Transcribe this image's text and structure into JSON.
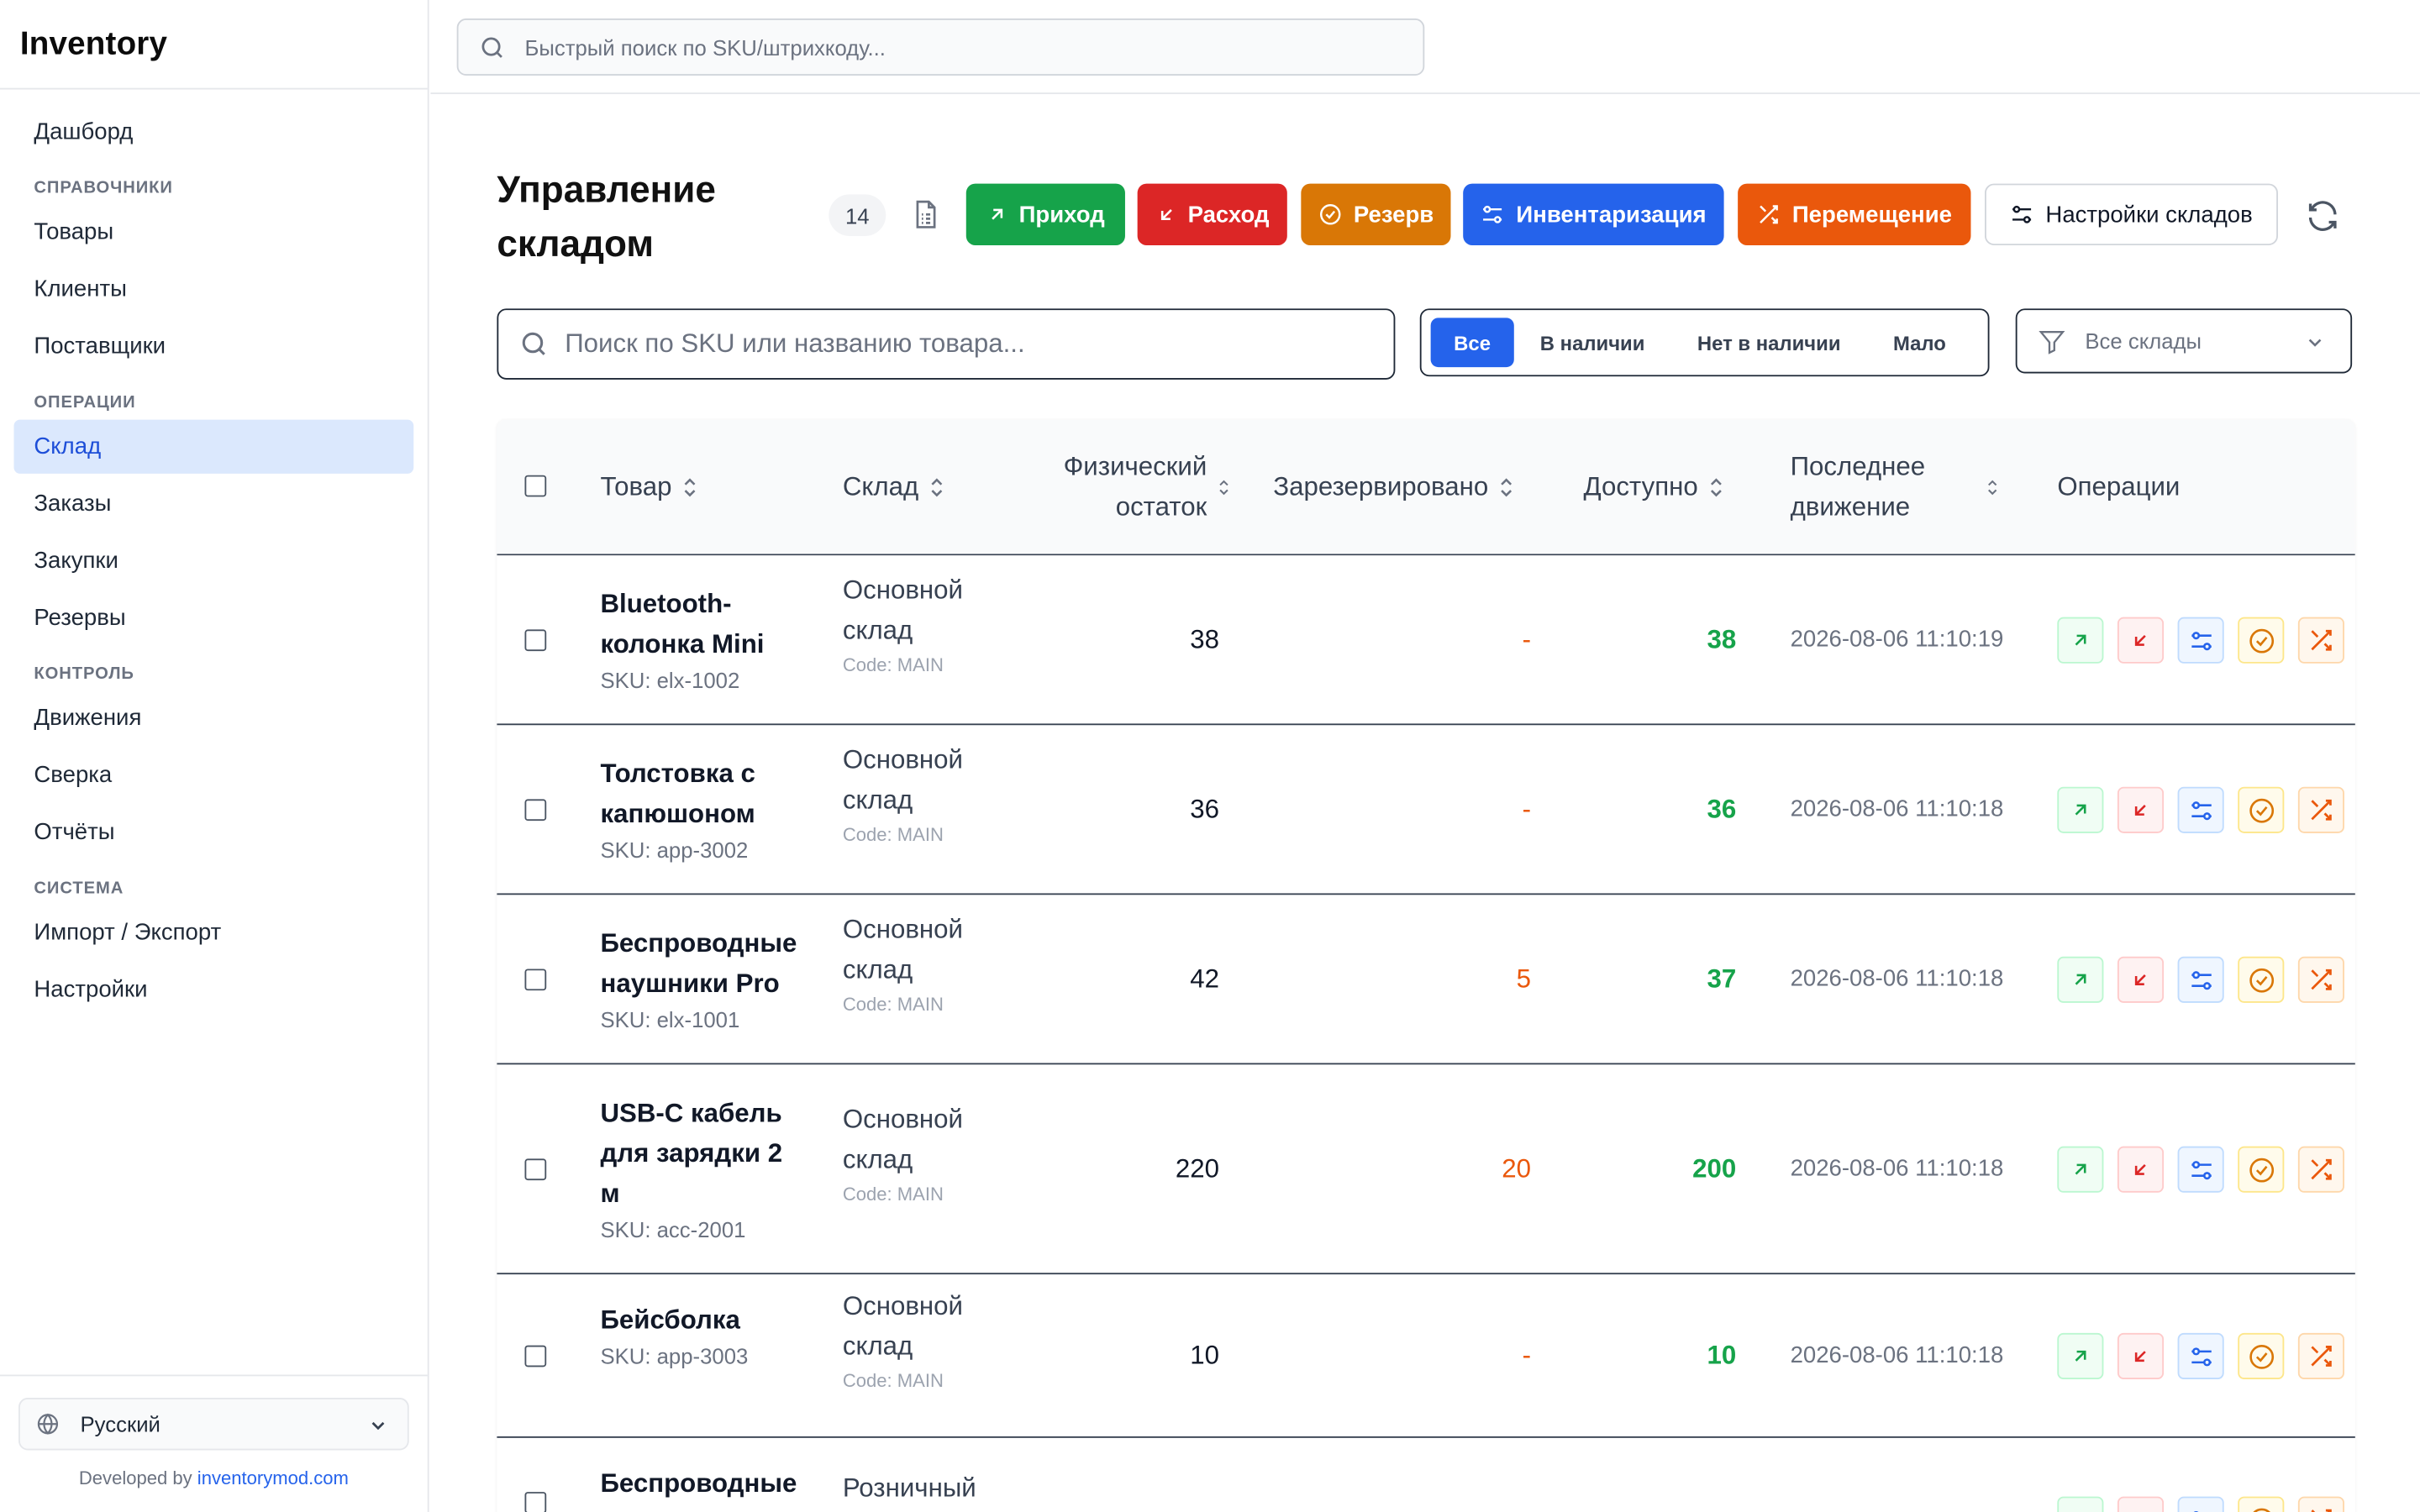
{
  "app": {
    "brand": "Inventory"
  },
  "sidebar": {
    "dashboard": "Дашборд",
    "sections": [
      {
        "title": "СПРАВОЧНИКИ",
        "items": [
          "Товары",
          "Клиенты",
          "Поставщики"
        ]
      },
      {
        "title": "ОПЕРАЦИИ",
        "items": [
          "Склад",
          "Заказы",
          "Закупки",
          "Резервы"
        ]
      },
      {
        "title": "КОНТРОЛЬ",
        "items": [
          "Движения",
          "Сверка",
          "Отчёты"
        ]
      },
      {
        "title": "СИСТЕМА",
        "items": [
          "Импорт / Экспорт",
          "Настройки"
        ]
      }
    ],
    "active": "Склад",
    "language": "Русский",
    "developed_by": "Developed by",
    "developer_link": "inventorymod.com"
  },
  "topbar": {
    "quick_search_placeholder": "Быстрый поиск по SKU/штрихкоду..."
  },
  "header": {
    "title": "Управление складом",
    "item_count": "14",
    "actions": {
      "receipt": "Приход",
      "expense": "Расход",
      "reserve": "Резерв",
      "inventory": "Инвентаризация",
      "transfer": "Перемещение",
      "settings": "Настройки складов"
    }
  },
  "filters": {
    "search_placeholder": "Поиск по SKU или названию товара...",
    "stock_tabs": [
      "Все",
      "В наличии",
      "Нет в наличии",
      "Мало"
    ],
    "active_tab": "Все",
    "warehouse_select": "Все склады"
  },
  "table": {
    "columns": {
      "product": "Товар",
      "warehouse": "Склад",
      "physical": "Физический остаток",
      "reserved": "Зарезервировано",
      "available": "Доступно",
      "last_movement": "Последнее движение",
      "operations": "Операции"
    },
    "rows": [
      {
        "name": "Bluetooth-колонка Mini",
        "sku": "SKU: elx-1002",
        "warehouse": "Основной склад",
        "code": "Code: MAIN",
        "physical": "38",
        "reserved": "-",
        "available": "38",
        "last": "2026-08-06 11:10:19"
      },
      {
        "name": "Толстовка с капюшоном",
        "sku": "SKU: app-3002",
        "warehouse": "Основной склад",
        "code": "Code: MAIN",
        "physical": "36",
        "reserved": "-",
        "available": "36",
        "last": "2026-08-06 11:10:18"
      },
      {
        "name": "Беспроводные наушники Pro",
        "sku": "SKU: elx-1001",
        "warehouse": "Основной склад",
        "code": "Code: MAIN",
        "physical": "42",
        "reserved": "5",
        "available": "37",
        "last": "2026-08-06 11:10:18"
      },
      {
        "name": "USB-C кабель для зарядки 2 м",
        "sku": "SKU: acc-2001",
        "warehouse": "Основной склад",
        "code": "Code: MAIN",
        "physical": "220",
        "reserved": "20",
        "available": "200",
        "last": "2026-08-06 11:10:18"
      },
      {
        "name": "Бейсболка",
        "sku": "SKU: app-3003",
        "warehouse": "Основной склад",
        "code": "Code: MAIN",
        "physical": "10",
        "reserved": "-",
        "available": "10",
        "last": "2026-08-06 11:10:18"
      },
      {
        "name": "Беспроводные",
        "sku": "",
        "warehouse": "Розничный",
        "code": "",
        "physical": "",
        "reserved": "",
        "available": "",
        "last": ""
      }
    ]
  },
  "colors": {
    "primary": "#2563eb",
    "success": "#16a34a",
    "danger": "#dc2626",
    "warning": "#d97706",
    "transfer": "#ea580c"
  }
}
